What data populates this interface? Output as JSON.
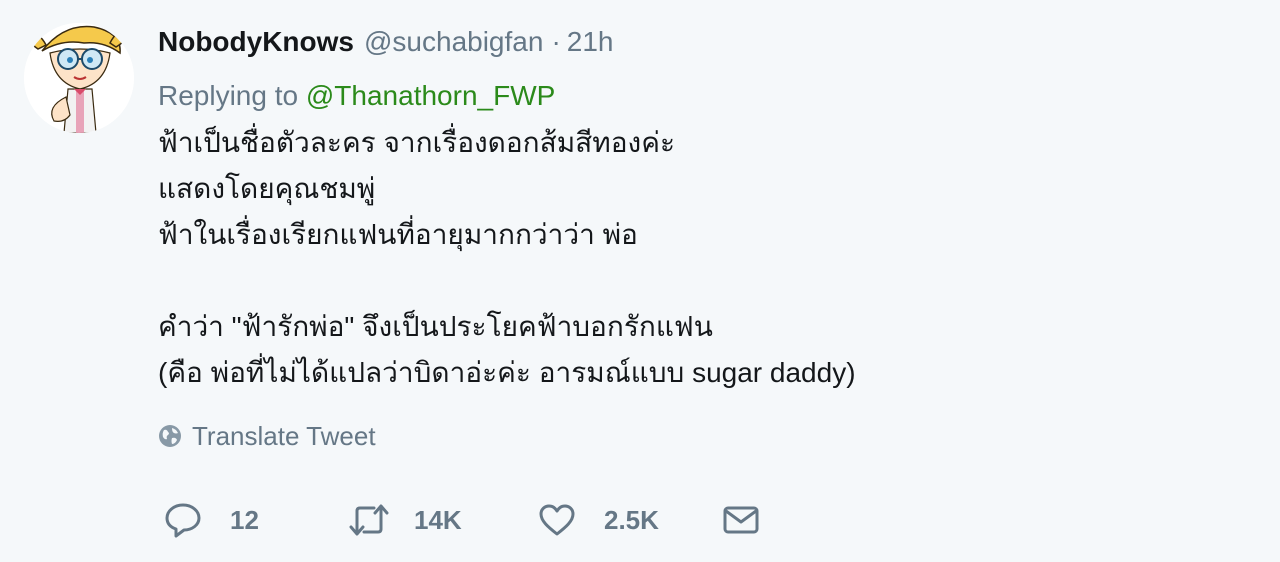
{
  "tweet": {
    "display_name": "NobodyKnows",
    "handle": "@suchabigfan",
    "separator": "·",
    "time": "21h",
    "reply_prefix": "Replying to",
    "reply_to": "@Thanathorn_FWP",
    "text_lines": [
      "ฟ้าเป็นชื่อตัวละคร จากเรื่องดอกส้มสีทองค่ะ",
      "แสดงโดยคุณชมพู่",
      "ฟ้าในเรื่องเรียกแฟนที่อายุมากกว่าว่า พ่อ",
      "",
      "คำว่า \"ฟ้ารักพ่อ\" จึงเป็นประโยคฟ้าบอกรักแฟน",
      "(คือ พ่อที่ไม่ได้แปลว่าบิดาอ่ะค่ะ อารมณ์แบบ sugar daddy)"
    ],
    "translate_label": "Translate Tweet",
    "actions": {
      "reply_count": "12",
      "retweet_count": "14K",
      "like_count": "2.5K"
    }
  },
  "colors": {
    "background": "#f5f8fa",
    "text_primary": "#14171a",
    "text_secondary": "#657786",
    "reply_link": "#2b8a1a"
  },
  "icons": {
    "translate": "globe-icon",
    "reply": "speech-bubble-icon",
    "retweet": "retweet-arrows-icon",
    "like": "heart-icon",
    "dm": "envelope-icon"
  }
}
